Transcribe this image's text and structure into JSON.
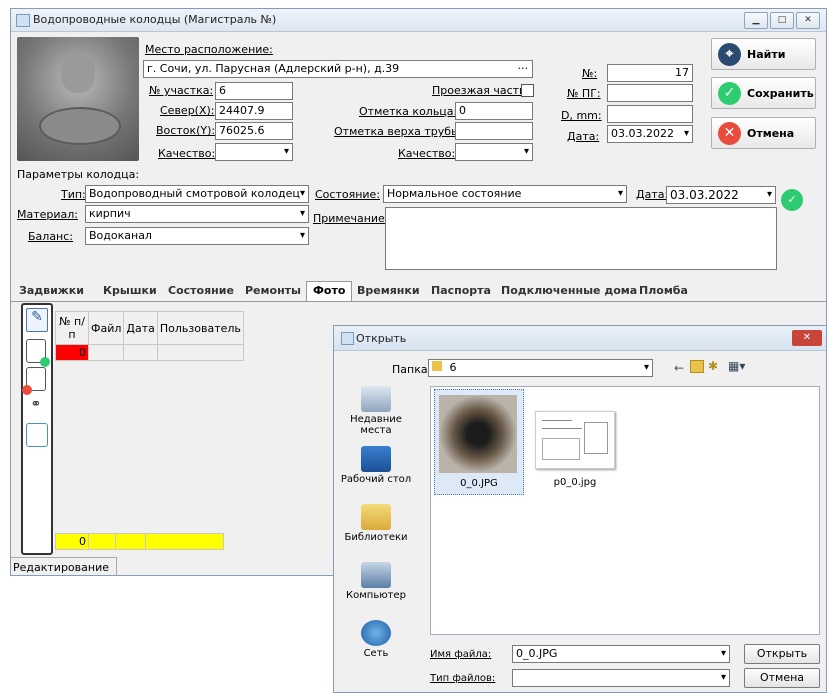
{
  "main_window": {
    "title": "Водопроводные колодцы (Магистраль №)",
    "location_label": "Место расположение:",
    "location_value": "г. Сочи, ул. Парусная (Адлерский р-н), д.39",
    "location_button": "...",
    "section_label": "№ участка:",
    "section_value": "6",
    "north_label": "Север(X):",
    "north_value": "24407.9",
    "east_label": "Восток(Y):",
    "east_value": "76025.6",
    "quality_label": "Качество:",
    "passage_label": "Проезжая часть",
    "ring_mark_label": "Отметка кольца:",
    "ring_mark_value": "0",
    "pipe_top_label": "Отметка верха трубы:",
    "quality2_label": "Качество:",
    "number_label": "№:",
    "number_value": "17",
    "pg_label": "№ ПГ:",
    "d_label": "D, mm:",
    "date_label": "Дата:",
    "date_value": "03.03.2022",
    "params_label": "Параметры колодца:",
    "type_label": "Тип:",
    "type_value": "Водопроводный смотровой колодец",
    "material_label": "Материал:",
    "material_value": "кирпич",
    "balance_label": "Баланс:",
    "balance_value": "Водоканал",
    "state_label": "Состояние:",
    "state_value": "Нормальное состояние",
    "state_date_label": "Дата:",
    "state_date_value": "03.03.2022",
    "note_label": "Примечание:",
    "status_text": "Редактирование"
  },
  "buttons": {
    "find": "Найти",
    "save": "Сохранить",
    "cancel": "Отмена"
  },
  "tabs": [
    "Задвижки",
    "Крышки",
    "Состояние",
    "Ремонты",
    "Фото",
    "Времянки",
    "Паспорта",
    "Подключенные дома",
    "Пломба"
  ],
  "active_tab": "Фото",
  "photo_table": {
    "headers": [
      "№ п/п",
      "Файл",
      "Дата",
      "Пользователь"
    ],
    "row_value": "0",
    "footer_value": "0"
  },
  "open_dialog": {
    "title": "Открыть",
    "folder_label": "Папка:",
    "folder_value": "6",
    "places": [
      "Недавние места",
      "Рабочий стол",
      "Библиотеки",
      "Компьютер",
      "Сеть"
    ],
    "files": [
      "0_0.JPG",
      "p0_0.jpg"
    ],
    "filename_label": "Имя файла:",
    "filename_value": "0_0.JPG",
    "filetype_label": "Тип файлов:",
    "open_button": "Открыть",
    "cancel_button": "Отмена"
  },
  "colors": {
    "save_green": "#2ecc71",
    "cancel_red": "#e74c3c",
    "row_red": "#ff0000",
    "footer_yellow": "#ffff00"
  }
}
